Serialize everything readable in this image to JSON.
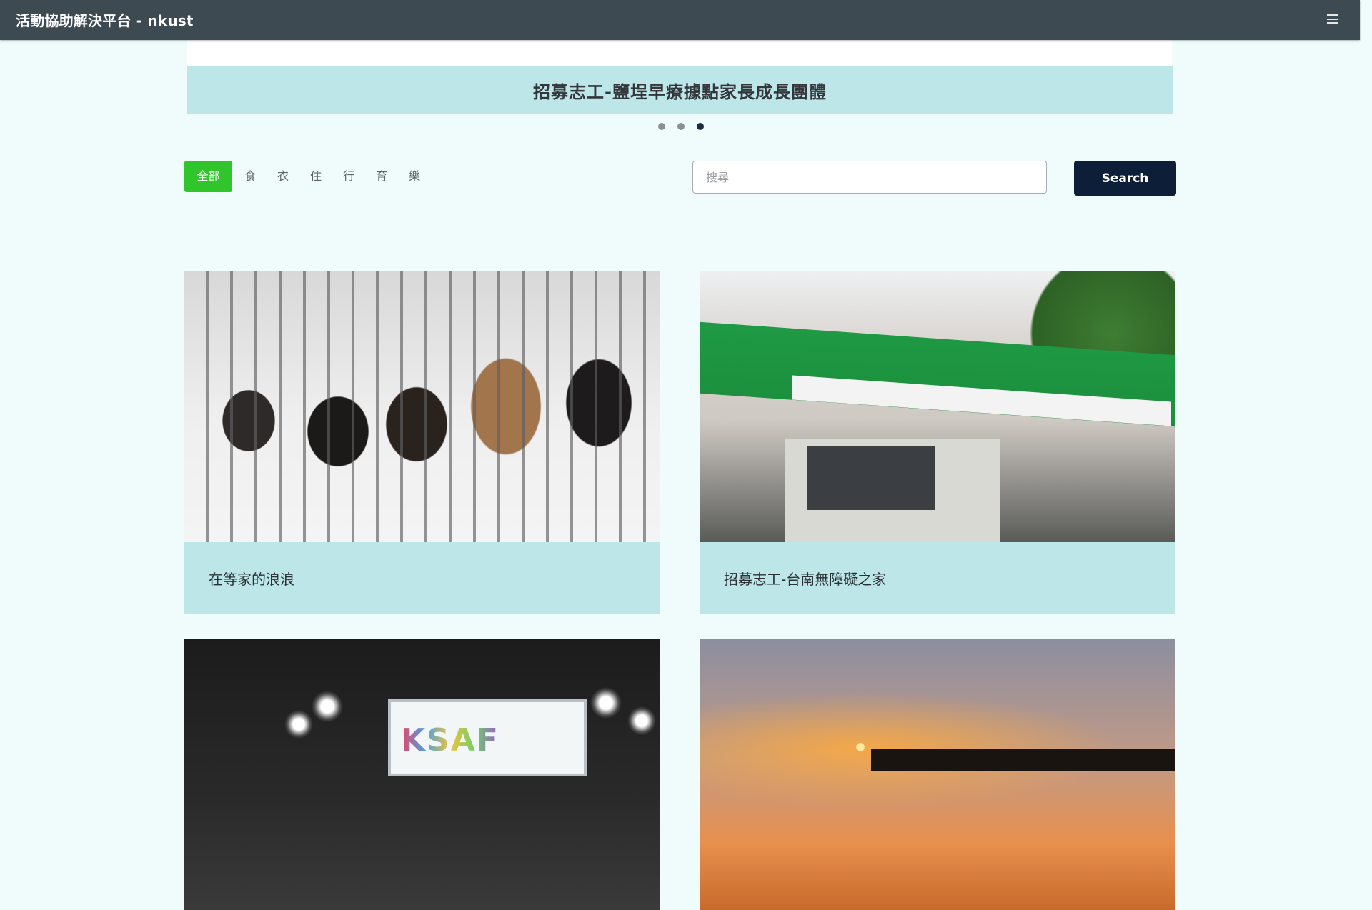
{
  "navbar": {
    "brand": "活動協助解決平台 - nkust",
    "menu_icon": "hamburger-menu-icon"
  },
  "carousel": {
    "caption": "招募志工-鹽埕早療據點家長成長團體",
    "indicator_count": 3,
    "active_index": 2
  },
  "categories": {
    "active": "全部",
    "items": [
      "全部",
      "食",
      "衣",
      "住",
      "行",
      "育",
      "樂"
    ]
  },
  "search": {
    "placeholder": "搜尋",
    "value": "",
    "button_label": "Search"
  },
  "cards": [
    {
      "title": "在等家的浪浪"
    },
    {
      "title": "招募志工-台南無障礙之家"
    },
    {
      "title": ""
    },
    {
      "title": ""
    }
  ],
  "colors": {
    "navbar": "#3e4a52",
    "page_background": "#effcfb",
    "card_body": "#bce6e8",
    "active_tab": "#30c52a",
    "search_button": "#0d1f38"
  }
}
